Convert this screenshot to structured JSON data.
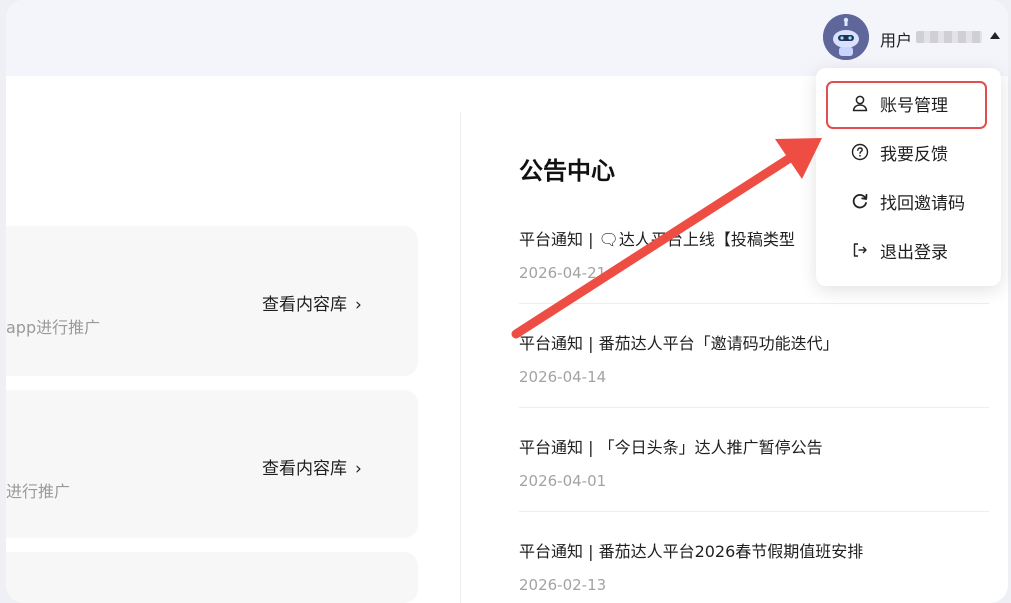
{
  "header": {
    "user_label": "用户"
  },
  "cards": [
    {
      "description": "app进行推广",
      "link_label": "查看内容库",
      "chevron": "›"
    },
    {
      "description": "进行推广",
      "link_label": "查看内容库",
      "chevron": "›"
    }
  ],
  "announcements": {
    "title": "公告中心",
    "items": [
      {
        "title": "平台通知 | 🗨达人平台上线【投稿类型",
        "date": "2026-04-21"
      },
      {
        "title": "平台通知 | 番茄达人平台「邀请码功能迭代」",
        "date": "2026-04-14"
      },
      {
        "title": "平台通知 | 「今日头条」达人推广暂停公告",
        "date": "2026-04-01"
      },
      {
        "title": "平台通知 | 番茄达人平台2026春节假期值班安排",
        "date": "2026-02-13"
      }
    ]
  },
  "dropdown": {
    "items": [
      {
        "label": "账号管理",
        "icon": "user-icon"
      },
      {
        "label": "我要反馈",
        "icon": "help-circle-icon"
      },
      {
        "label": "找回邀请码",
        "icon": "refresh-icon"
      },
      {
        "label": "退出登录",
        "icon": "logout-icon"
      }
    ]
  },
  "colors": {
    "highlight": "#e24e4e",
    "arrow": "#ee4d43"
  }
}
